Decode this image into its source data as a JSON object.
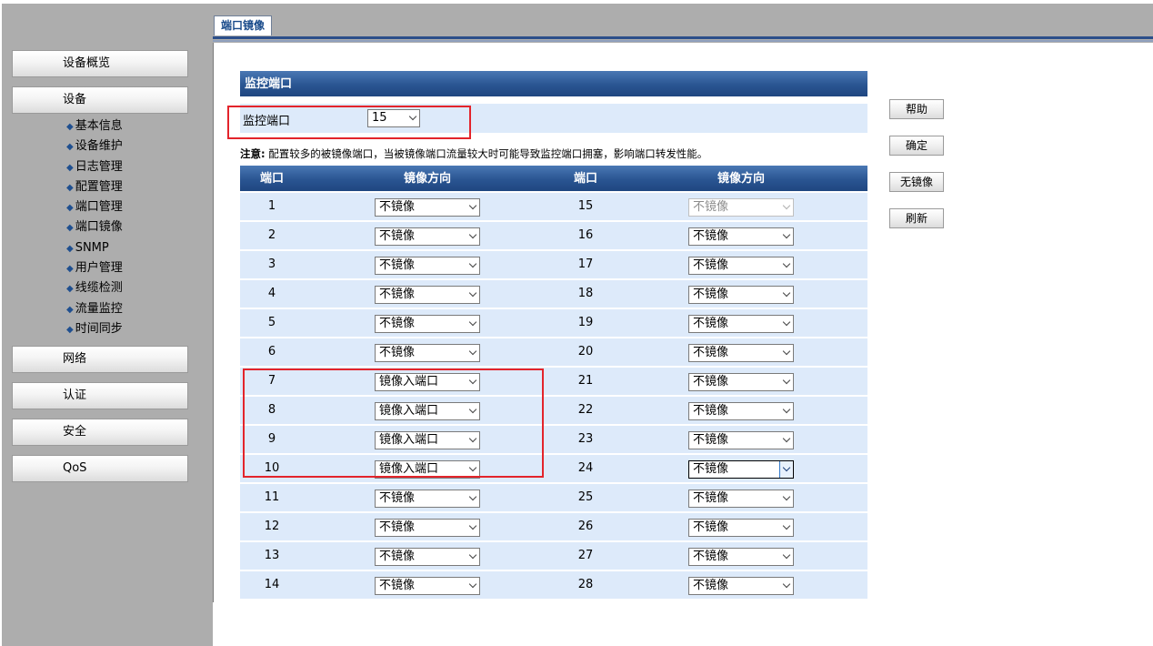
{
  "tab": {
    "label": "端口镜像"
  },
  "sidebar": {
    "menu": [
      "设备概览",
      "设备",
      "网络",
      "认证",
      "安全",
      "QoS"
    ],
    "submenu": [
      "基本信息",
      "设备维护",
      "日志管理",
      "配置管理",
      "端口管理",
      "端口镜像",
      "SNMP",
      "用户管理",
      "线缆检测",
      "流量监控",
      "时间同步"
    ]
  },
  "monitor": {
    "section_title": "监控端口",
    "label": "监控端口",
    "value": "15"
  },
  "note": {
    "prefix": "注意:",
    "text": " 配置较多的被镜像端口，当被镜像端口流量较大时可能导致监控端口拥塞，影响端口转发性能。"
  },
  "table": {
    "headers": {
      "port": "端口",
      "direction": "镜像方向"
    },
    "left": [
      {
        "port": "1",
        "direction": "不镜像"
      },
      {
        "port": "2",
        "direction": "不镜像"
      },
      {
        "port": "3",
        "direction": "不镜像"
      },
      {
        "port": "4",
        "direction": "不镜像"
      },
      {
        "port": "5",
        "direction": "不镜像"
      },
      {
        "port": "6",
        "direction": "不镜像"
      },
      {
        "port": "7",
        "direction": "镜像入端口"
      },
      {
        "port": "8",
        "direction": "镜像入端口"
      },
      {
        "port": "9",
        "direction": "镜像入端口"
      },
      {
        "port": "10",
        "direction": "镜像入端口"
      },
      {
        "port": "11",
        "direction": "不镜像"
      },
      {
        "port": "12",
        "direction": "不镜像"
      },
      {
        "port": "13",
        "direction": "不镜像"
      },
      {
        "port": "14",
        "direction": "不镜像"
      }
    ],
    "right": [
      {
        "port": "15",
        "direction": "不镜像",
        "disabled": true
      },
      {
        "port": "16",
        "direction": "不镜像"
      },
      {
        "port": "17",
        "direction": "不镜像"
      },
      {
        "port": "18",
        "direction": "不镜像"
      },
      {
        "port": "19",
        "direction": "不镜像"
      },
      {
        "port": "20",
        "direction": "不镜像"
      },
      {
        "port": "21",
        "direction": "不镜像"
      },
      {
        "port": "22",
        "direction": "不镜像"
      },
      {
        "port": "23",
        "direction": "不镜像"
      },
      {
        "port": "24",
        "direction": "不镜像",
        "focused": true
      },
      {
        "port": "25",
        "direction": "不镜像"
      },
      {
        "port": "26",
        "direction": "不镜像"
      },
      {
        "port": "27",
        "direction": "不镜像"
      },
      {
        "port": "28",
        "direction": "不镜像"
      }
    ]
  },
  "buttons": {
    "help": "帮助",
    "confirm": "确定",
    "no_mirror": "无镜像",
    "refresh": "刷新"
  },
  "colors": {
    "header_blue": "#2a5592",
    "row_bg": "#ddeafa",
    "highlight_red": "#e3242b",
    "sidebar_gray": "#adadad"
  }
}
